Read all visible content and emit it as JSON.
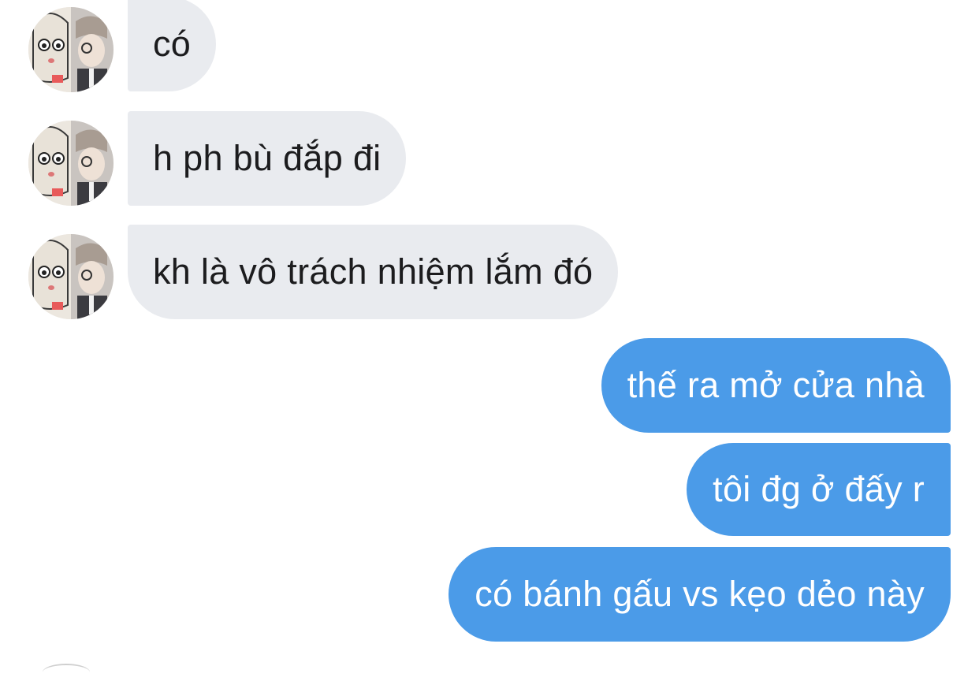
{
  "conversation": {
    "incoming": [
      {
        "text": "có",
        "avatar_icon": "avatar-collage-icon"
      },
      {
        "text": "h ph bù đắp đi",
        "avatar_icon": "avatar-collage-icon"
      },
      {
        "text": "kh là vô trách nhiệm lắm đó",
        "avatar_icon": "avatar-collage-icon"
      }
    ],
    "outgoing": [
      {
        "text": "thế ra mở cửa nhà"
      },
      {
        "text": "tôi đg ở đấy r"
      },
      {
        "text": "có bánh gấu vs kẹo dẻo này"
      }
    ]
  },
  "colors": {
    "incoming_bubble": "#e9ebef",
    "incoming_text": "#1c1c1e",
    "outgoing_bubble": "#4b9be8",
    "outgoing_text": "#ffffff",
    "background": "#ffffff"
  }
}
